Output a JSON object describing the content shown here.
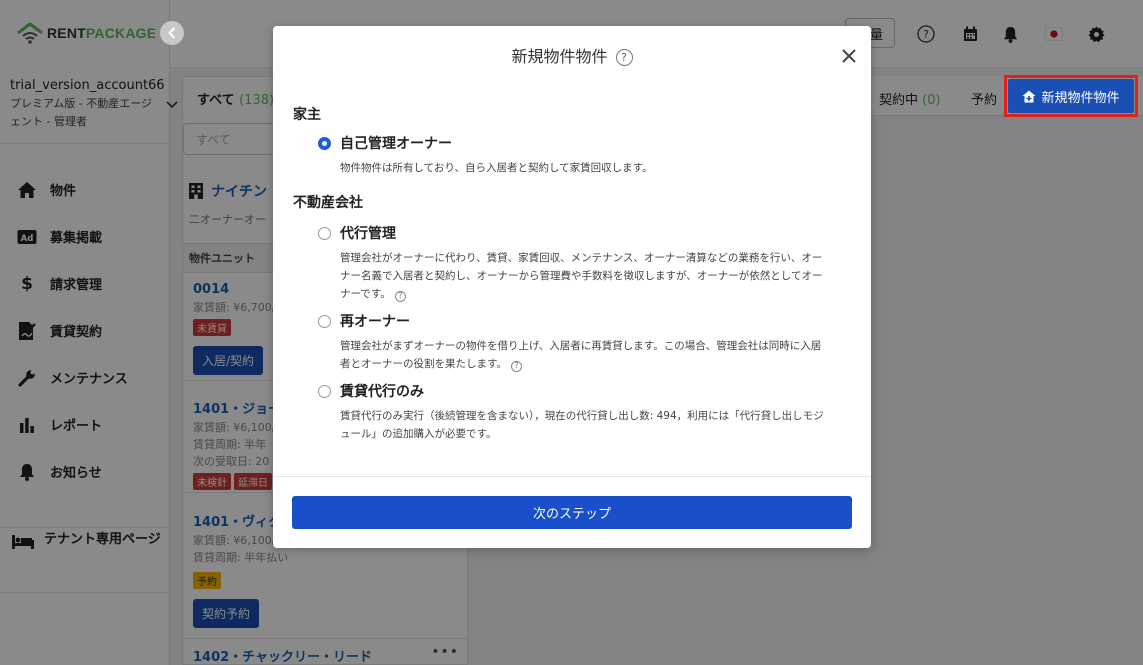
{
  "brand": {
    "rent": "RENT",
    "package": "PACKAGE"
  },
  "account": {
    "name": "trial_version_account66",
    "plan": "プレミアム版 - 不動産エージェント - 管理者"
  },
  "nav": [
    {
      "label": "物件",
      "icon": "home-icon"
    },
    {
      "label": "募集掲載",
      "icon": "ad-icon"
    },
    {
      "label": "請求管理",
      "icon": "dollar-icon"
    },
    {
      "label": "賃貸契約",
      "icon": "contract-icon"
    },
    {
      "label": "メンテナンス",
      "icon": "wrench-icon"
    },
    {
      "label": "レポート",
      "icon": "chart-icon"
    },
    {
      "label": "お知らせ",
      "icon": "bell-icon"
    }
  ],
  "tenant_page": "テナント専用ページ",
  "topbar": {
    "partial_button": "量"
  },
  "list": {
    "tab_all": "すべて",
    "tab_all_count": "(138)",
    "search_placeholder": "すべて",
    "group_title": "ナイチン",
    "group_sub": "二オーナーオー",
    "units_header": "物件ユニット",
    "units": [
      {
        "title": "0014",
        "lines": [
          "家賃額: ¥6,700/"
        ],
        "badges": [
          "未賃貸"
        ],
        "button": "入居/契約"
      },
      {
        "title": "1401・ジョー",
        "lines": [
          "家賃額: ¥6,100/",
          "賃貸周期: 半年",
          "次の受取日: 20"
        ],
        "badges": [
          "未検針",
          "延滞日"
        ]
      },
      {
        "title": "1401・ヴィク",
        "lines": [
          "家賃額: ¥6,100/",
          "賃貸周期: 半年払い"
        ],
        "badges": [
          "予約"
        ],
        "button": "契約予約"
      },
      {
        "title": "1402・チャックリー・リード",
        "lines": []
      }
    ]
  },
  "right": {
    "tab_active": "契約中",
    "tab_active_count": "(0)",
    "tab_reserve": "予約",
    "new_property_button": "新規物件物件"
  },
  "modal": {
    "title": "新規物件物件",
    "help": "?",
    "section_owner": "家主",
    "section_agency": "不動産会社",
    "options": [
      {
        "title": "自己管理オーナー",
        "desc": "物件物件は所有しており、自ら入居者と契約して家賃回収します。",
        "checked": true
      },
      {
        "title": "代行管理",
        "desc": "管理会社がオーナーに代わり、賃貸、家賃回収、メンテナンス、オーナー清算などの業務を行い、オーナー名義で入居者と契約し、オーナーから管理費や手数料を徴収しますが、オーナーが依然としてオーナーです。",
        "checked": false
      },
      {
        "title": "再オーナー",
        "desc": "管理会社がまずオーナーの物件を借り上げ、入居者に再賃貸します。この場合、管理会社は同時に入居者とオーナーの役割を果たします。",
        "checked": false
      },
      {
        "title": "賃貸代行のみ",
        "desc": "賃貸代行のみ実行（後続管理を含まない），現在の代行貸し出し数: 494，利用には「代行貸し出しモジュール」の追加購入が必要です。",
        "checked": false
      }
    ],
    "next_button": "次のステップ"
  },
  "colors": {
    "accent": "#1a4fcc",
    "brand_green": "#5fb85a",
    "highlight": "#e0201a"
  }
}
